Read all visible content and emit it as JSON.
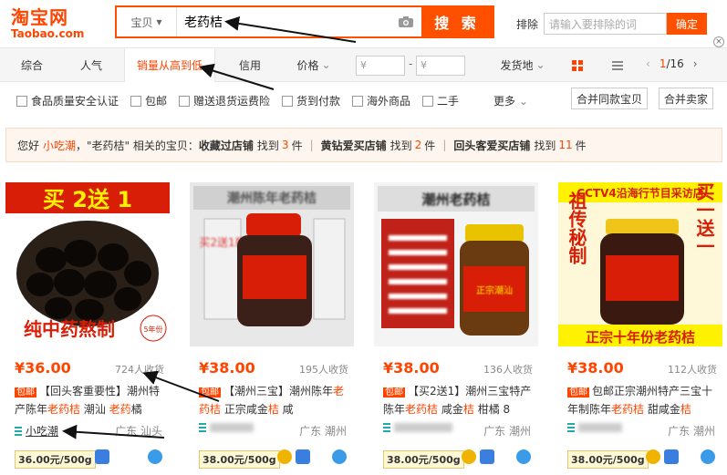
{
  "header": {
    "logo_cn": "淘宝网",
    "logo_en": "Taobao.com",
    "search_category": "宝贝",
    "search_query": "老药桔",
    "search_button": "搜 索",
    "exclude_label": "排除",
    "exclude_placeholder": "请输入要排除的词",
    "exclude_button": "确定"
  },
  "sortbar": {
    "tabs": [
      "综合",
      "人气",
      "销量从高到低",
      "信用",
      "价格"
    ],
    "price_from": "¥",
    "price_to": "¥",
    "dash": "-",
    "ship_from": "发货地",
    "page_current": "1",
    "page_total": "/16"
  },
  "filters": {
    "checkboxes": [
      "食品质量安全认证",
      "包邮",
      "赠送退货运费险",
      "货到付款",
      "海外商品",
      "二手"
    ],
    "more": "更多",
    "merge_items": "合并同款宝贝",
    "merge_sellers": "合并卖家"
  },
  "notice": {
    "hello": "您好",
    "user": "小吃潮",
    "related": "，\"老药桔\" 相关的宝贝：",
    "g1_label": "收藏过店铺",
    "g1_found": "找到",
    "g1_count": "3",
    "g1_unit": "件",
    "g2_label": "黄钻爱买店铺",
    "g2_found": "找到",
    "g2_count": "2",
    "g2_unit": "件",
    "g3_label": "回头客爱买店铺",
    "g3_found": "找到",
    "g3_count": "11",
    "g3_unit": "件"
  },
  "products": [
    {
      "img_banner": "买 2送 1",
      "img_footer": "纯中药熬制",
      "img_corner": "5年份",
      "price": "¥36.00",
      "sold": "724人收货",
      "tag": "包邮",
      "title_a": "【回头客重要性】潮州特产陈年",
      "title_kw1": "老药桔",
      "title_b": " 潮汕 ",
      "title_kw2": "老药",
      "title_c": "橘",
      "seller": "小吃潮",
      "location": "广东 汕头",
      "unit_price": "36.00元/500g"
    },
    {
      "img_banner": "潮州陈年老药桔",
      "img_side": "买2送1瓶",
      "price": "¥38.00",
      "sold": "195人收货",
      "tag": "包邮",
      "title_a": "【潮州三宝】潮州陈年",
      "title_kw1": "老药桔",
      "title_b": " 正宗咸金",
      "title_kw2": "桔",
      "title_c": " 咸",
      "location": "广东 潮州",
      "unit_price": "38.00元/500g"
    },
    {
      "img_banner": "潮州老药桔",
      "img_label": "正宗潮汕",
      "price": "¥38.00",
      "sold": "136人收货",
      "tag": "包邮",
      "title_a": "【买2送1】潮州三宝特产 陈年",
      "title_kw1": "老药桔",
      "title_b": " 咸金",
      "title_kw2": "桔",
      "title_c": " 柑橘 8",
      "location": "广东 潮州",
      "unit_price": "38.00元/500g"
    },
    {
      "img_banner": "CCTV4沿海行节目采访店",
      "img_left": "祖传秘制",
      "img_right": "买一送一",
      "img_footer": "正宗十年份老药桔",
      "price": "¥38.00",
      "sold": "112人收货",
      "tag": "包邮",
      "title_a": "包邮正宗潮州特产三宝十年制陈年",
      "title_kw1": "老药桔",
      "title_b": " 甜咸金",
      "title_kw2": "桔",
      "title_c": "",
      "location": "广东 潮州",
      "unit_price": "38.00元/500g"
    }
  ],
  "colors": {
    "brand": "#ff4400",
    "search_border": "#ff5000"
  }
}
